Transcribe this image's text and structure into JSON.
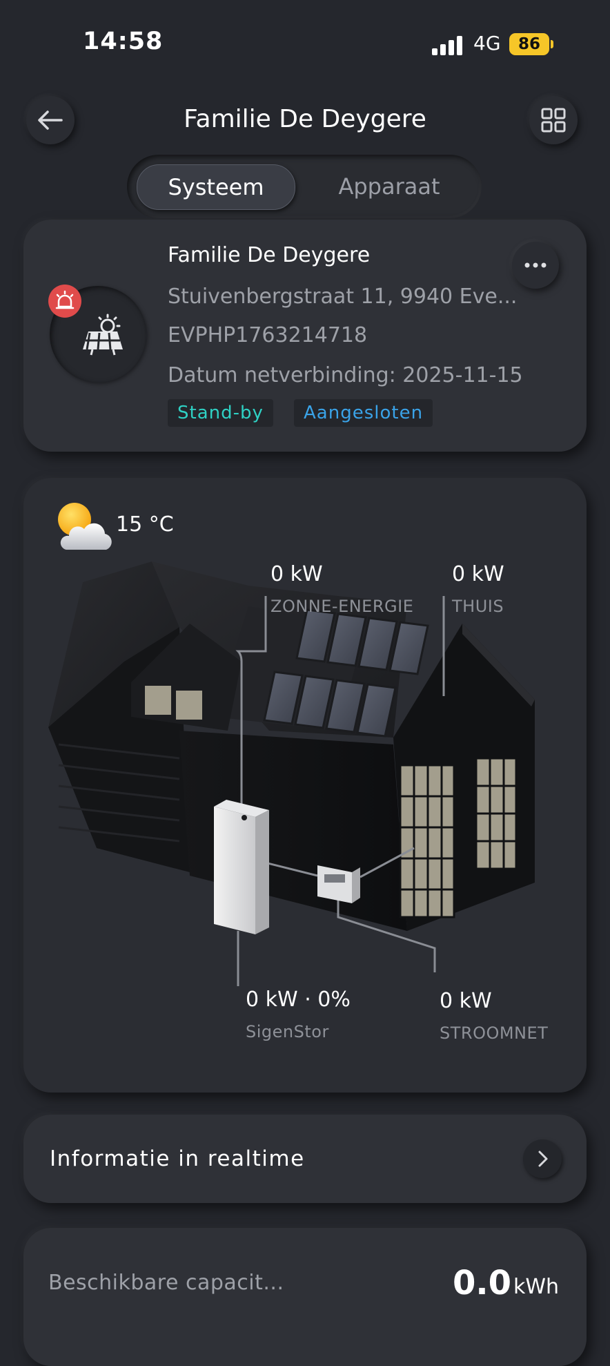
{
  "status_bar": {
    "time": "14:58",
    "network": "4G",
    "battery": "86"
  },
  "header": {
    "title": "Familie De Deygere"
  },
  "tabs": [
    {
      "label": "Systeem",
      "active": true
    },
    {
      "label": "Apparaat",
      "active": false
    }
  ],
  "system_card": {
    "name": "Familie De Deygere",
    "address": "Stuivenbergstraat 11, 9940 Eve...",
    "serial": "EVPHP1763214718",
    "grid_date": "Datum netverbinding: 2025-11-15",
    "tags": [
      "Stand-by",
      "Aangesloten"
    ]
  },
  "weather": {
    "temperature": "15 °C"
  },
  "energy_flow": {
    "solar": {
      "value": "0 kW",
      "label": "ZONNE-ENERGIE"
    },
    "home": {
      "value": "0 kW",
      "label": "THUIS"
    },
    "battery": {
      "value": "0 kW · 0%",
      "label": "SigenStor"
    },
    "grid": {
      "value": "0 kW",
      "label": "STROOMNET"
    }
  },
  "realtime": {
    "label": "Informatie in realtime"
  },
  "capacity": {
    "label": "Beschikbare capacit...",
    "value": "0.0",
    "unit": "kWh"
  },
  "colors": {
    "background": "#25272d",
    "card": "#2f3137",
    "alert": "#e04b4b",
    "standby": "#2fd1c4",
    "connected": "#3aa3e8",
    "battery_badge": "#f6c628"
  },
  "icons": [
    "back-arrow-icon",
    "grid-view-icon",
    "solar-panel-icon",
    "alarm-icon",
    "more-icon",
    "weather-partly-cloudy-icon",
    "chevron-right-icon",
    "signal-icon",
    "battery-icon"
  ]
}
